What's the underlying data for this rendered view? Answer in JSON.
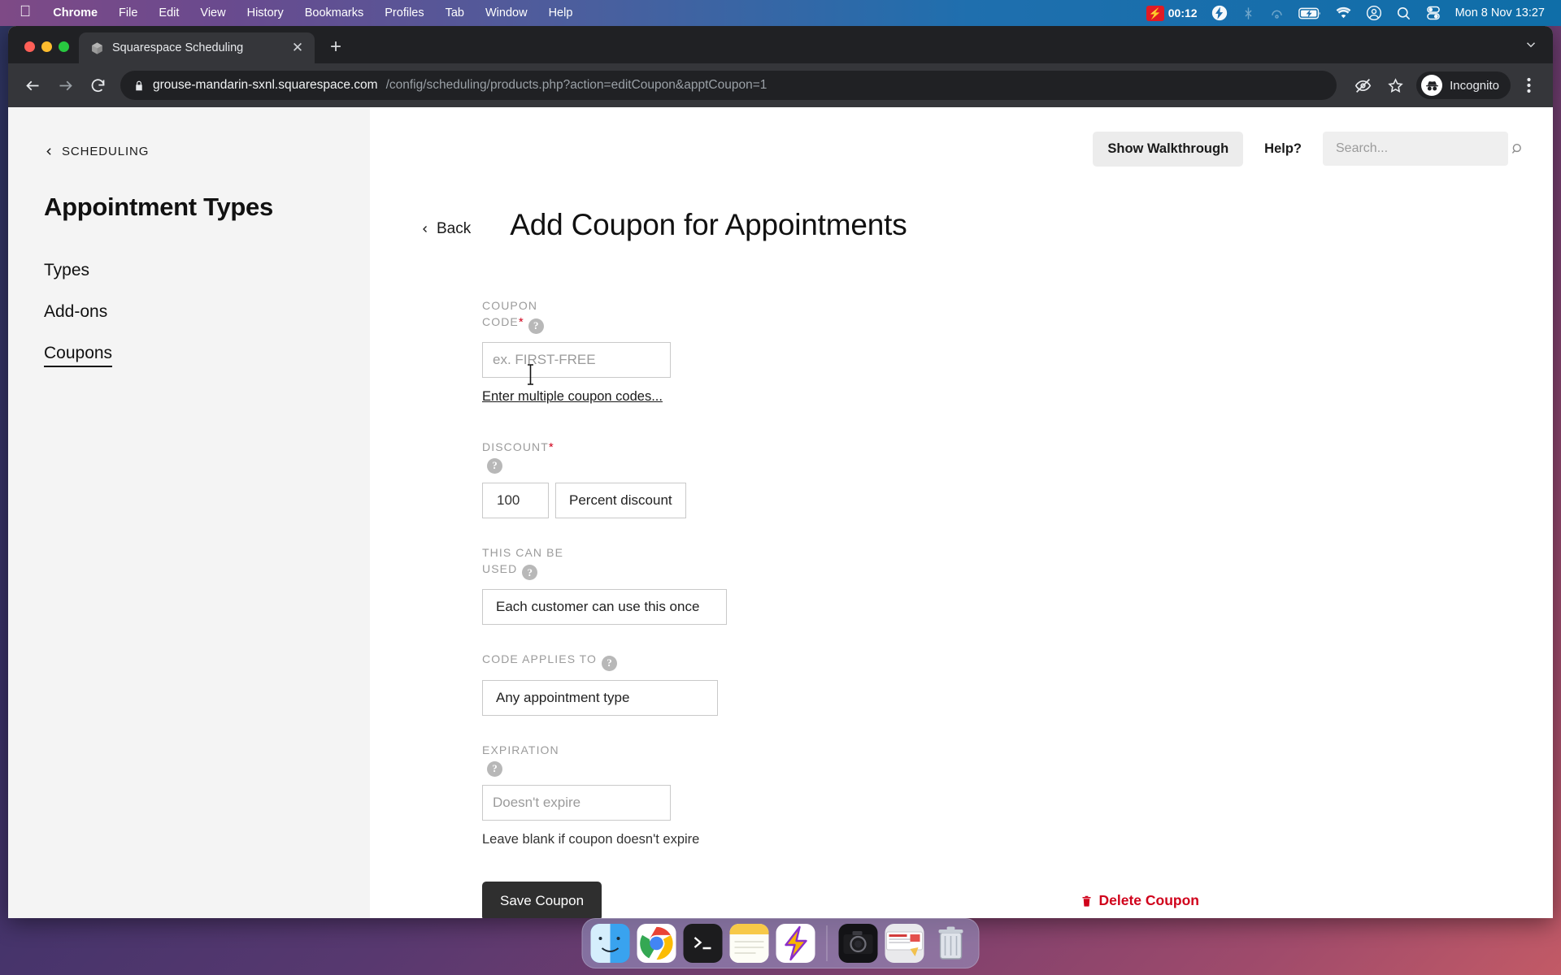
{
  "menubar": {
    "apple_icon": "apple-logo",
    "items": [
      {
        "label": "Chrome",
        "bold": true
      },
      {
        "label": "File",
        "bold": false
      },
      {
        "label": "Edit",
        "bold": false
      },
      {
        "label": "View",
        "bold": false
      },
      {
        "label": "History",
        "bold": false
      },
      {
        "label": "Bookmarks",
        "bold": false
      },
      {
        "label": "Profiles",
        "bold": false
      },
      {
        "label": "Tab",
        "bold": false
      },
      {
        "label": "Window",
        "bold": false
      },
      {
        "label": "Help",
        "bold": false
      }
    ],
    "recording_time": "00:12",
    "status_icons": [
      "screen-record-icon",
      "bolt-icon",
      "bluetooth-off-icon",
      "airdrop-icon",
      "battery-charging-icon",
      "wifi-icon",
      "user-account-icon",
      "spotlight-search-icon",
      "control-center-icon"
    ],
    "clock": "Mon 8 Nov  13:27"
  },
  "browser": {
    "tab": {
      "title": "Squarespace Scheduling",
      "favicon": "squarespace-cube-icon",
      "close_icon": "close-icon"
    },
    "new_tab_icon": "plus-icon",
    "tab_list_icon": "chevron-down-icon",
    "nav": {
      "back_icon": "arrow-left-icon",
      "forward_icon": "arrow-right-icon",
      "reload_icon": "reload-icon"
    },
    "omnibox": {
      "lock_icon": "lock-icon",
      "url_host": "grouse-mandarin-sxnl.squarespace.com",
      "url_path": "/config/scheduling/products.php?action=editCoupon&apptCoupon=1"
    },
    "extensions_icon": "eye-off-icon",
    "bookmark_icon": "star-icon",
    "profile": {
      "label": "Incognito",
      "icon": "incognito-icon"
    },
    "menu_icon": "three-dot-menu-icon"
  },
  "sidebar": {
    "back_label": "SCHEDULING",
    "back_icon": "chevron-left-icon",
    "heading": "Appointment Types",
    "items": [
      {
        "label": "Types",
        "active": false
      },
      {
        "label": "Add-ons",
        "active": false
      },
      {
        "label": "Coupons",
        "active": true
      }
    ]
  },
  "header": {
    "walkthrough_label": "Show Walkthrough",
    "help_label": "Help?",
    "search_placeholder": "Search...",
    "search_value": "",
    "search_icon": "search-icon"
  },
  "page": {
    "back_label": "Back",
    "back_icon": "chevron-left-icon",
    "title": "Add Coupon for Appointments"
  },
  "form": {
    "coupon_code": {
      "label": "COUPON CODE",
      "required": "*",
      "help_icon": "help-circle-icon",
      "placeholder": "ex. FIRST-FREE",
      "value": "",
      "multi_link": "Enter multiple coupon codes..."
    },
    "discount": {
      "label": "DISCOUNT",
      "required": "*",
      "help_icon": "help-circle-icon",
      "amount": "100",
      "type": "Percent discount"
    },
    "usage": {
      "label_line1": "THIS CAN BE",
      "label_line2": "USED",
      "help_icon": "help-circle-icon",
      "value": "Each customer can use this once"
    },
    "applies_to": {
      "label_line1": "CODE APPLIES",
      "label_line2": "TO",
      "help_icon": "help-circle-icon",
      "value": "Any appointment type"
    },
    "expiration": {
      "label": "EXPIRATION",
      "help_icon": "help-circle-icon",
      "placeholder": "Doesn't expire",
      "value": "",
      "hint": "Leave blank if coupon doesn't expire"
    },
    "save_label": "Save Coupon",
    "delete_label": "Delete Coupon",
    "delete_icon": "trash-icon"
  },
  "dock": {
    "items": [
      {
        "name": "finder-icon",
        "running": true
      },
      {
        "name": "chrome-icon",
        "running": true
      },
      {
        "name": "terminal-icon",
        "running": true
      },
      {
        "name": "notes-icon",
        "running": true
      },
      {
        "name": "bolt-app-icon",
        "running": true
      },
      {
        "name": "camera-icon",
        "running": false
      },
      {
        "name": "screenshot-icon",
        "running": false
      },
      {
        "name": "trash-icon",
        "running": false
      }
    ]
  },
  "colors": {
    "accent_red": "#d0021b",
    "dark_button": "#2f2f2f",
    "sidebar_bg": "#f4f4f4"
  }
}
